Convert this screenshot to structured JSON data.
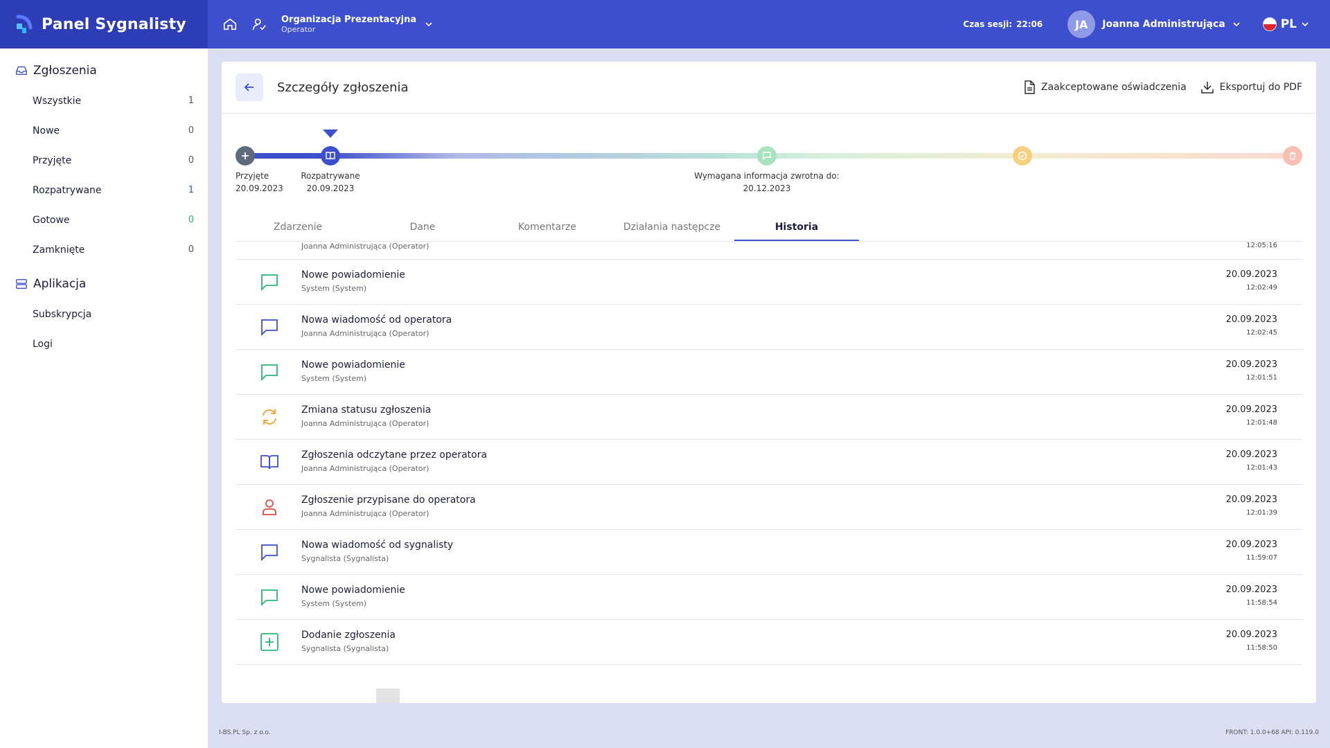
{
  "brand": {
    "name": "Panel Sygnalisty"
  },
  "topbar": {
    "org_name": "Organizacja Prezentacyjna",
    "org_role": "Operator",
    "session_label": "Czas sesji:",
    "session_time": "22:06",
    "avatar_initials": "JA",
    "user_name": "Joanna Administrująca",
    "lang": "PL"
  },
  "sidebar": {
    "section1": "Zgłoszenia",
    "items": [
      {
        "label": "Wszystkie",
        "count": "1"
      },
      {
        "label": "Nowe",
        "count": "0"
      },
      {
        "label": "Przyjęte",
        "count": "0"
      },
      {
        "label": "Rozpatrywane",
        "count": "1"
      },
      {
        "label": "Gotowe",
        "count": "0"
      },
      {
        "label": "Zamknięte",
        "count": "0"
      }
    ],
    "section2": "Aplikacja",
    "app_items": [
      {
        "label": "Subskrypcja"
      },
      {
        "label": "Logi"
      }
    ]
  },
  "card": {
    "title": "Szczegóły zgłoszenia",
    "action_accepted": "Zaakceptowane oświadczenia",
    "action_export": "Eksportuj do PDF"
  },
  "timeline": {
    "steps": [
      {
        "label": "Przyjęte",
        "date": "20.09.2023"
      },
      {
        "label": "Rozpatrywane",
        "date": "20.09.2023"
      },
      {
        "label": "Wymagana informacja zwrotna do:",
        "date": "20.12.2023"
      }
    ]
  },
  "tabs": [
    "Zdarzenie",
    "Dane",
    "Komentarze",
    "Działania następcze",
    "Historia"
  ],
  "history": {
    "partial": {
      "sub": "Joanna Administrująca (Operator)",
      "time": "12:05:16"
    },
    "rows": [
      {
        "icon": "chat-green-icon",
        "title": "Nowe powiadomienie",
        "sub": "System (System)",
        "date": "20.09.2023",
        "time": "12:02:49"
      },
      {
        "icon": "chat-blue-icon",
        "title": "Nowa wiadomość od operatora",
        "sub": "Joanna Administrująca (Operator)",
        "date": "20.09.2023",
        "time": "12:02:45"
      },
      {
        "icon": "chat-green-icon",
        "title": "Nowe powiadomienie",
        "sub": "System (System)",
        "date": "20.09.2023",
        "time": "12:01:51"
      },
      {
        "icon": "refresh-orange-icon",
        "title": "Zmiana statusu zgłoszenia",
        "sub": "Joanna Administrująca (Operator)",
        "date": "20.09.2023",
        "time": "12:01:48"
      },
      {
        "icon": "book-blue-icon",
        "title": "Zgłoszenia odczytane przez operatora",
        "sub": "Joanna Administrująca (Operator)",
        "date": "20.09.2023",
        "time": "12:01:43"
      },
      {
        "icon": "user-red-icon",
        "title": "Zgłoszenie przypisane do operatora",
        "sub": "Joanna Administrująca (Operator)",
        "date": "20.09.2023",
        "time": "12:01:39"
      },
      {
        "icon": "chat-blue-icon",
        "title": "Nowa wiadomość od sygnalisty",
        "sub": "Sygnalista (Sygnalista)",
        "date": "20.09.2023",
        "time": "11:59:07"
      },
      {
        "icon": "chat-green-icon",
        "title": "Nowe powiadomienie",
        "sub": "System (System)",
        "date": "20.09.2023",
        "time": "11:58:54"
      },
      {
        "icon": "plus-square-green-icon",
        "title": "Dodanie zgłoszenia",
        "sub": "Sygnalista (Sygnalista)",
        "date": "20.09.2023",
        "time": "11:58:50"
      }
    ]
  },
  "footer": {
    "left": "I-BS.PL Sp. z o.o.",
    "right": "FRONT: 1.0.0+68  API: 0.119.0"
  },
  "colors": {
    "primary": "#3d4fcc",
    "brand_bg": "#2d3db5",
    "green": "#2bb673",
    "orange": "#f2a12e",
    "red": "#e5483f"
  }
}
